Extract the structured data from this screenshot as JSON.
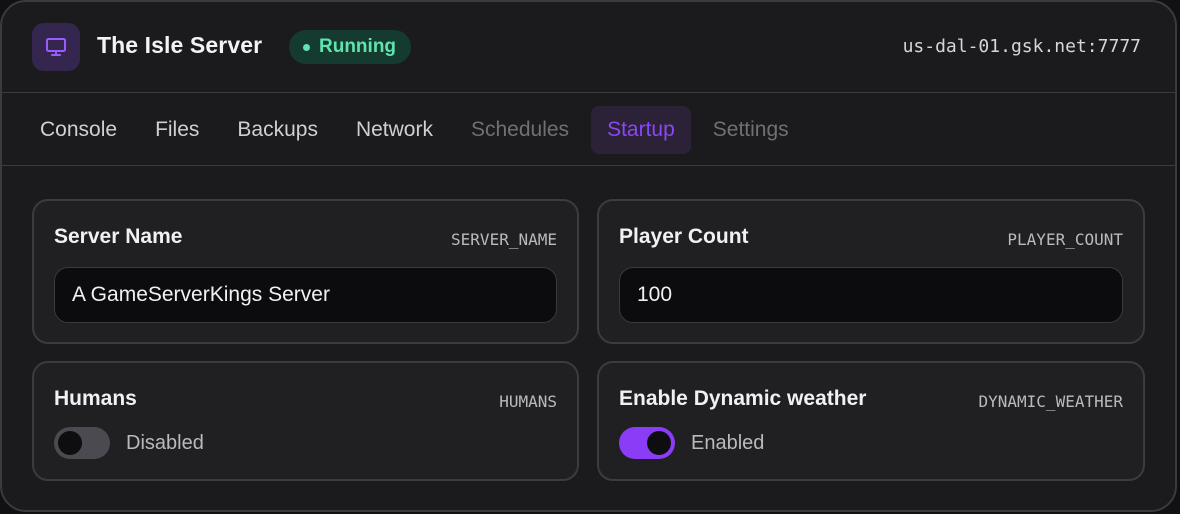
{
  "header": {
    "title": "The Isle Server",
    "icon": "monitor-icon",
    "status": "Running",
    "status_color": "#5fe3b0",
    "address": "us-dal-01.gsk.net:7777"
  },
  "tabs": [
    {
      "label": "Console",
      "state": "normal"
    },
    {
      "label": "Files",
      "state": "normal"
    },
    {
      "label": "Backups",
      "state": "normal"
    },
    {
      "label": "Network",
      "state": "normal"
    },
    {
      "label": "Schedules",
      "state": "muted"
    },
    {
      "label": "Startup",
      "state": "active"
    },
    {
      "label": "Settings",
      "state": "muted"
    }
  ],
  "accent_color": "#8b3cf7",
  "variables": {
    "server_name": {
      "label": "Server Name",
      "var": "SERVER_NAME",
      "value": "A GameServerKings Server"
    },
    "player_count": {
      "label": "Player Count",
      "var": "PLAYER_COUNT",
      "value": "100"
    },
    "humans": {
      "label": "Humans",
      "var": "HUMANS",
      "state_text": "Disabled",
      "enabled": false
    },
    "dynamic_weather": {
      "label": "Enable Dynamic weather",
      "var": "DYNAMIC_WEATHER",
      "state_text": "Enabled",
      "enabled": true
    }
  }
}
